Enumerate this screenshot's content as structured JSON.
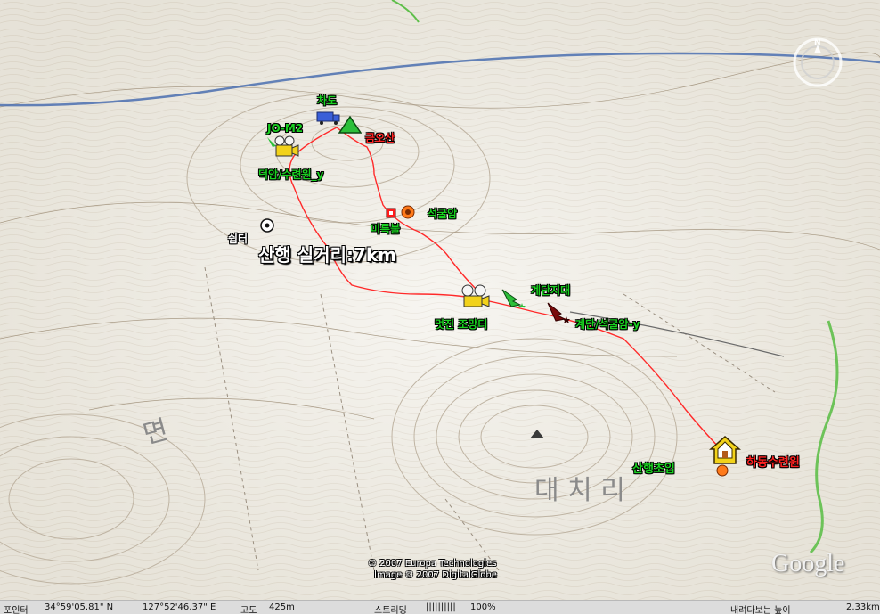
{
  "map": {
    "labels": {
      "chado": "차도",
      "gwanosan": "금오산",
      "jo_m2": "JO-M2",
      "deokam": "덕암/수련원_y",
      "seokgulam": "석굴암",
      "mireukbul": "미륵불",
      "shimteo": "쉼터",
      "distance": "산행 실거리:7km",
      "gyedan": "계단지대",
      "gyedan_seokgulam": "계단/석굴암-y",
      "viewpoint": "멋진 조망터",
      "trail_start": "산행초입",
      "hadong": "하동수련원"
    },
    "terrain_text": {
      "daechi": "대 치 리",
      "myeon": "면"
    },
    "copyright": {
      "line1": "© 2007 Europa Technologies",
      "line2": "Image © 2007 DigitalGlobe"
    },
    "logo": "Google",
    "colors": {
      "route": "#ff2a2a",
      "label_green": "#19d020",
      "label_red": "#ff2222",
      "river": "#4a6fb0",
      "boundary": "#5fbf4a"
    }
  },
  "status": {
    "lat_label": "포인터",
    "lat": "34°59'05.81\" N",
    "lon": "127°52'46.37\" E",
    "elev_label": "고도",
    "elev": "425m",
    "stream_label": "스트리밍",
    "stream_bars": "||||||||||",
    "stream_pct": "100%",
    "view_label": "내려다보는 높이",
    "view_alt": "2.33km"
  },
  "compass": {
    "north": "N",
    "icon": "navigation-compass-icon"
  }
}
